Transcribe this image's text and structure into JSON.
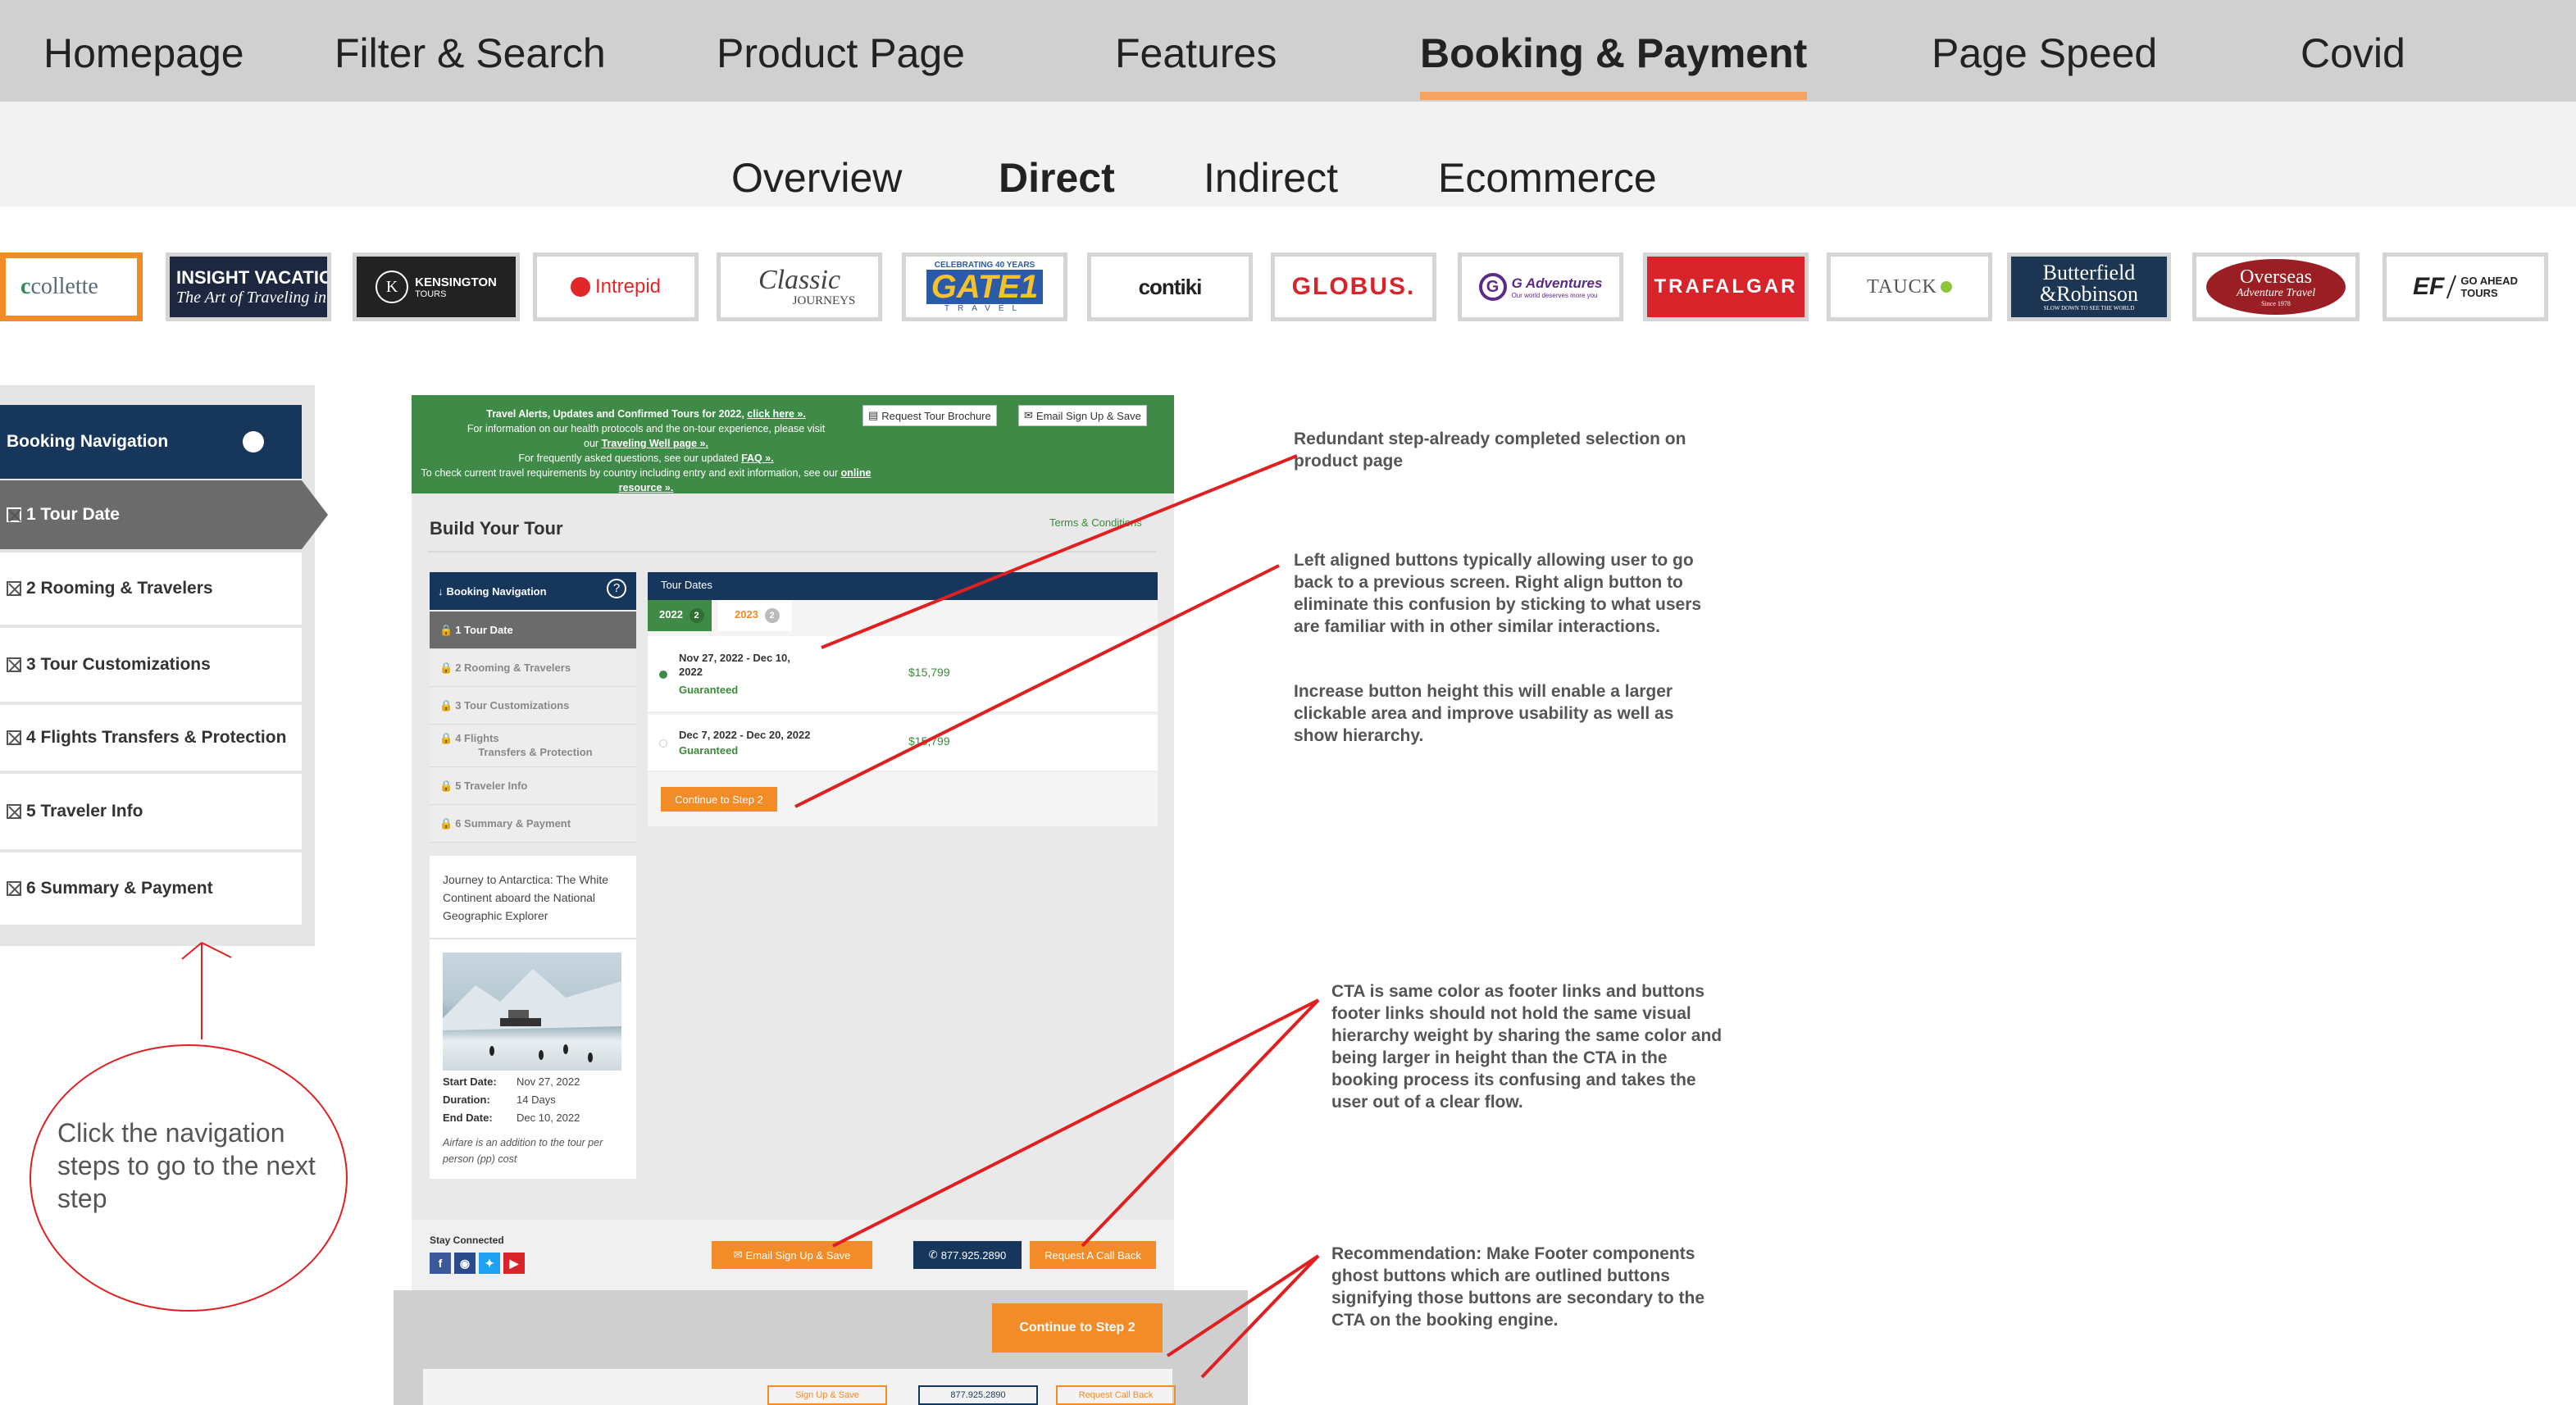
{
  "top_nav": {
    "items": [
      "Homepage",
      "Filter & Search",
      "Product Page",
      "Features",
      "Booking & Payment",
      "Page Speed",
      "Covid"
    ],
    "active": "Booking & Payment"
  },
  "sub_nav": {
    "items": [
      "Overview",
      "Direct",
      "Indirect",
      "Ecommerce"
    ],
    "active": "Direct"
  },
  "brands": {
    "collette": "collette",
    "insight_1": "INSIGHT VACATIO",
    "insight_2": "The Art of Traveling in S",
    "kensington_1": "KENSINGTON",
    "kensington_2": "TOURS",
    "intrepid": "Intrepid",
    "classic_1": "Classic",
    "classic_2": "JOURNEYS",
    "gate1_top": "CELEBRATING 40 YEARS",
    "gate1": "GATE1",
    "gate1_bottom": "TRAVEL",
    "contiki": "contiki",
    "globus": "GLOBUS.",
    "gadventures_1": "G Adventures",
    "gadventures_2": "Our world deserves more you",
    "trafalgar": "TRAFALGAR",
    "tauck": "TAUCK",
    "butterfield_1": "Butterfield",
    "butterfield_2": "&Robinson",
    "butterfield_3": "SLOW DOWN TO SEE THE WORLD",
    "overseas_1": "Overseas",
    "overseas_2": "Adventure Travel",
    "overseas_3": "Since 1978",
    "ef_1": "EF",
    "ef_2": "GO AHEAD",
    "ef_3": "TOURS"
  },
  "big_nav": {
    "header": "Booking Navigation",
    "steps": [
      "1 Tour Date",
      "2 Rooming & Travelers",
      "3 Tour Customizations",
      "4 Flights Transfers & Protection",
      "5 Traveler Info",
      "6 Summary & Payment"
    ]
  },
  "circle_note": "Click the navigation steps to go to the next step",
  "notes": {
    "n1": "Redundant step-already completed selection on product page",
    "n2a": "Left aligned buttons typically allowing user to go back to a previous screen. Right align button to eliminate this confusion by sticking to what users are familiar with in other similar interactions.",
    "n2b": "Increase button height this will enable a larger clickable area and improve usability as well as show hierarchy.",
    "n3": "CTA is same color as footer links and buttons footer links should not hold the same visual hierarchy weight by sharing the same color and being larger in height than the CTA in the booking process its confusing and takes the user out of a clear flow.",
    "n4": "Recommendation: Make Footer components ghost buttons which are outlined buttons signifying those buttons are secondary to the CTA on the booking engine."
  },
  "screenshot": {
    "alert": {
      "l1": "Travel Alerts, Updates and Confirmed Tours for 2022,",
      "l1_link": "click here ».",
      "l2": "For information on our health protocols and the on-tour experience, please visit",
      "l3": "our",
      "l3_link": "Traveling Well page ».",
      "l4": "For frequently asked questions, see our updated",
      "l4_link": "FAQ ».",
      "l5": "To check current travel requirements by country including entry and exit information, see our",
      "l5_link": "online resource »."
    },
    "request_brochure": "Request Tour Brochure",
    "email_signup": "Email Sign Up & Save",
    "build_title": "Build Your Tour",
    "terms": "Terms & Conditions",
    "nav": {
      "header": "Booking Navigation",
      "help": "?",
      "steps": [
        "1 Tour Date",
        "2 Rooming & Travelers",
        "3 Tour Customizations",
        "4 Flights",
        "Transfers & Protection",
        "5 Traveler Info",
        "6 Summary & Payment"
      ]
    },
    "tour_dates": {
      "header": "Tour Dates",
      "tab_2022": "2022",
      "tab_2022_count": "2",
      "tab_2023": "2023",
      "tab_2023_count": "2",
      "rows": [
        {
          "date1": "Nov 27, 2022 - Dec 10,",
          "date2": "2022",
          "status": "Guaranteed",
          "price": "$15,799"
        },
        {
          "date1": "Dec 7, 2022 - Dec 20, 2022",
          "status": "Guaranteed",
          "price": "$15,799"
        }
      ],
      "continue": "Continue to Step 2"
    },
    "card": {
      "title": "Journey to Antarctica: The White Continent aboard the National Geographic Explorer",
      "start_label": "Start Date:",
      "start": "Nov 27, 2022",
      "duration_label": "Duration:",
      "duration": "14 Days",
      "end_label": "End Date:",
      "end": "Dec 10, 2022",
      "airfare": "Airfare is an addition to the tour per person (pp) cost"
    },
    "footer": {
      "stay": "Stay Connected",
      "email": "Email Sign Up & Save",
      "phone": "877.925.2890",
      "callback": "Request A Call Back"
    },
    "zoom": {
      "continue": "Continue to Step 2",
      "signup": "Sign Up & Save",
      "phone": "877.925.2890",
      "callback": "Request Call Back"
    }
  },
  "colors": {
    "accent": "#f28c28",
    "nav_dark": "#16365c",
    "alert_green": "#3f8a47",
    "annotation_red": "#e02020"
  }
}
